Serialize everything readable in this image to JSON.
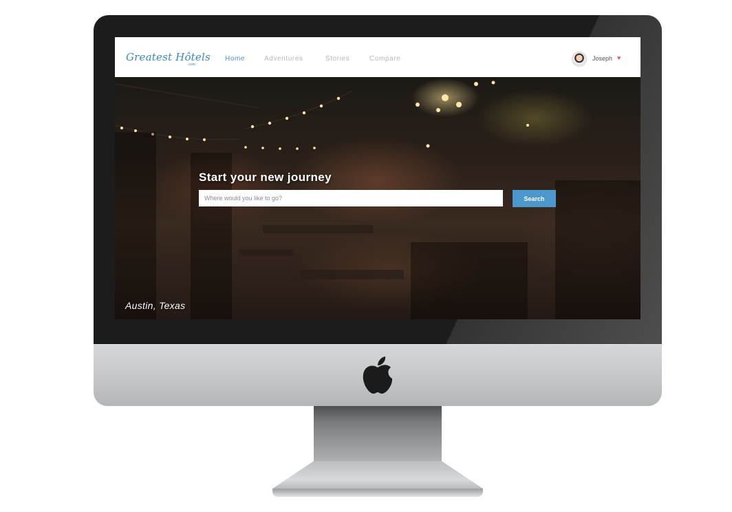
{
  "site": {
    "logo_text": "Greatest Hôtels",
    "logo_sub": ".com"
  },
  "nav": {
    "items": [
      {
        "label": "Home",
        "active": true
      },
      {
        "label": "Adventures",
        "active": false
      },
      {
        "label": "Stories",
        "active": false
      },
      {
        "label": "Compare",
        "active": false
      }
    ]
  },
  "user": {
    "name": "Joseph",
    "menu_icon": "heart-icon"
  },
  "hero": {
    "title": "Start your new journey",
    "search_placeholder": "Where would you like to go?",
    "search_button": "Search",
    "location": "Austin, Texas"
  },
  "colors": {
    "accent": "#4c98cd",
    "logo": "#3a86c2",
    "nav_inactive": "#b3b7bb",
    "heart": "#e65a5a"
  }
}
